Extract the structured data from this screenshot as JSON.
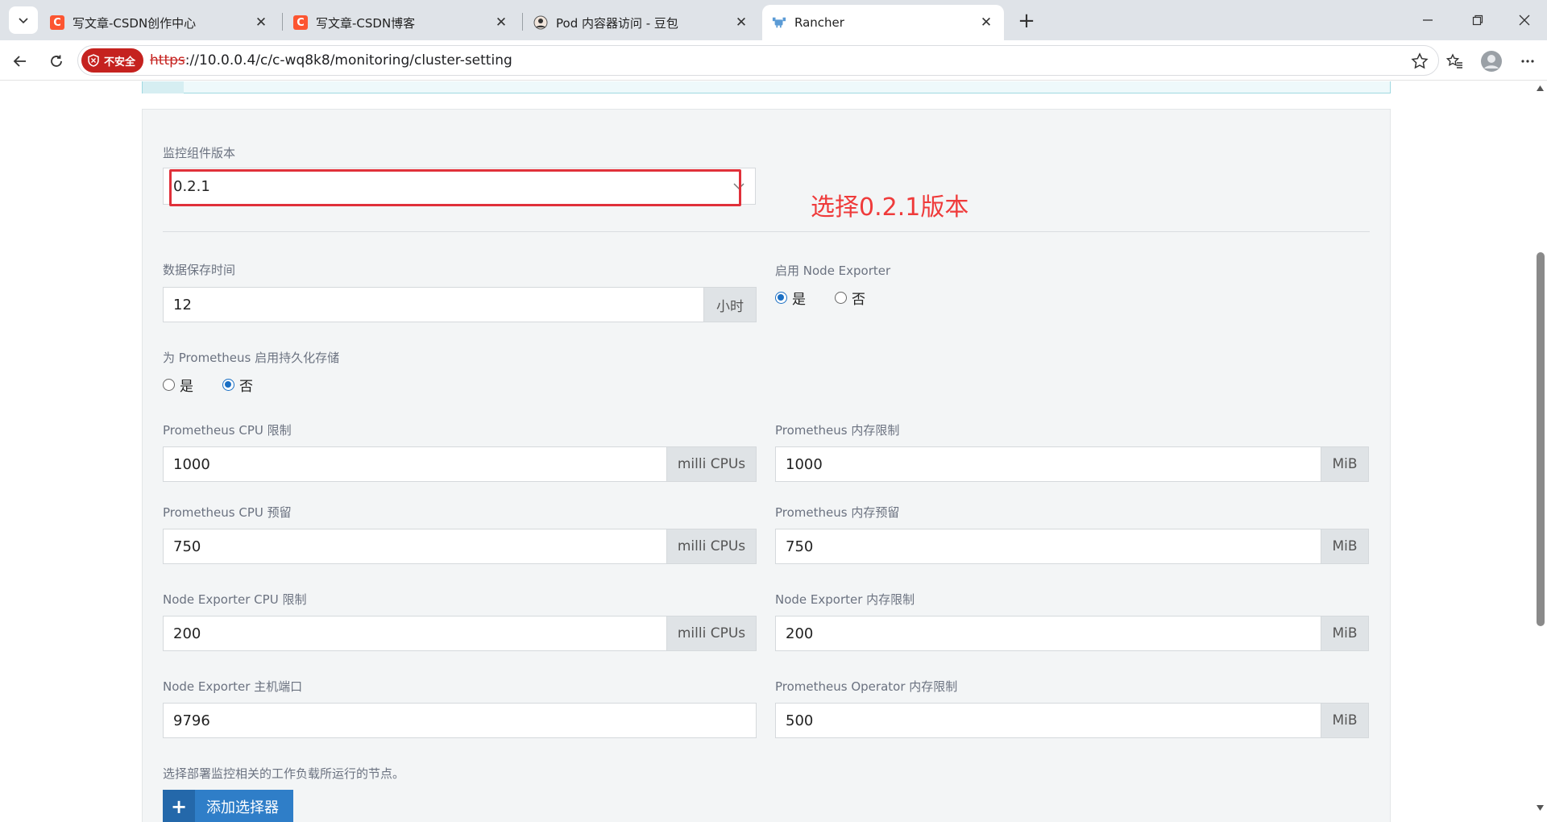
{
  "browser": {
    "tabs": [
      {
        "label": "写文章-CSDN创作中心",
        "favicon": "csdn-c-icon",
        "active": false
      },
      {
        "label": "写文章-CSDN博客",
        "favicon": "csdn-c-icon",
        "active": false
      },
      {
        "label": "Pod 内容器访问 - 豆包",
        "favicon": "doubao-avatar-icon",
        "active": false
      },
      {
        "label": "Rancher",
        "favicon": "rancher-cow-icon",
        "active": true
      }
    ],
    "security_badge": "不安全",
    "url_scheme": "https",
    "url_rest": "://10.0.0.4/c/c-wq8k8/monitoring/cluster-setting"
  },
  "form": {
    "version": {
      "label": "监控组件版本",
      "value": "0.2.1"
    },
    "annotation": "选择0.2.1版本",
    "retention": {
      "label": "数据保存时间",
      "value": "12",
      "unit": "小时"
    },
    "node_exporter_enable": {
      "label": "启用 Node Exporter",
      "yes": "是",
      "no": "否",
      "selected": "yes"
    },
    "persistent_storage": {
      "label": "为 Prometheus 启用持久化存储",
      "yes": "是",
      "no": "否",
      "selected": "no"
    },
    "prom_cpu_limit": {
      "label": "Prometheus CPU 限制",
      "value": "1000",
      "unit": "milli CPUs"
    },
    "prom_mem_limit": {
      "label": "Prometheus 内存限制",
      "value": "1000",
      "unit": "MiB"
    },
    "prom_cpu_reserve": {
      "label": "Prometheus CPU 预留",
      "value": "750",
      "unit": "milli CPUs"
    },
    "prom_mem_reserve": {
      "label": "Prometheus 内存预留",
      "value": "750",
      "unit": "MiB"
    },
    "ne_cpu_limit": {
      "label": "Node Exporter CPU 限制",
      "value": "200",
      "unit": "milli CPUs"
    },
    "ne_mem_limit": {
      "label": "Node Exporter 内存限制",
      "value": "200",
      "unit": "MiB"
    },
    "ne_host_port": {
      "label": "Node Exporter 主机端口",
      "value": "9796"
    },
    "operator_mem_limit": {
      "label": "Prometheus Operator 内存限制",
      "value": "500",
      "unit": "MiB"
    },
    "node_selector_hint": "选择部署监控相关的工作负载所运行的节点。",
    "add_selector_label": "添加选择器"
  },
  "colors": {
    "accent": "#2f7ec8",
    "annotation_red": "#ef3b3b",
    "insecure_red": "#c5221f"
  }
}
